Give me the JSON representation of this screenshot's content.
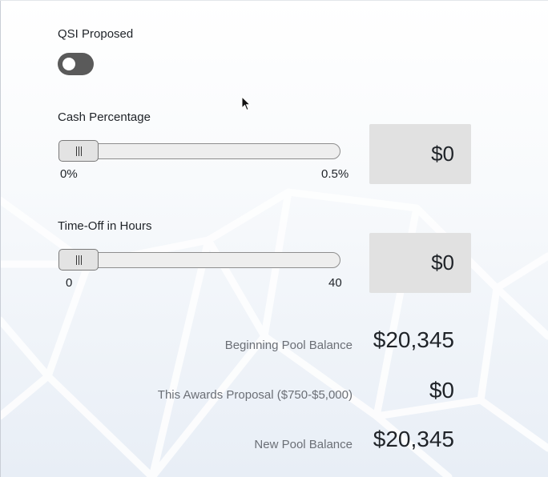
{
  "qsi": {
    "label": "QSI Proposed",
    "enabled": false
  },
  "cash": {
    "label": "Cash Percentage",
    "min_label": "0%",
    "max_label": "0.5%",
    "value_percent": 0,
    "amount": "$0"
  },
  "timeoff": {
    "label": "Time-Off in Hours",
    "min_label": "0",
    "max_label": "40",
    "value_hours": 0,
    "amount": "$0"
  },
  "summary": {
    "beginning_label": "Beginning Pool Balance",
    "beginning_value": "$20,345",
    "proposal_label": "This Awards Proposal ($750-$5,000)",
    "proposal_value": "$0",
    "new_label": "New Pool Balance",
    "new_value": "$20,345"
  },
  "colors": {
    "toggle_off": "#5a5a5a",
    "value_box": "#e1e1e1",
    "summary_label": "#6b6f76"
  }
}
